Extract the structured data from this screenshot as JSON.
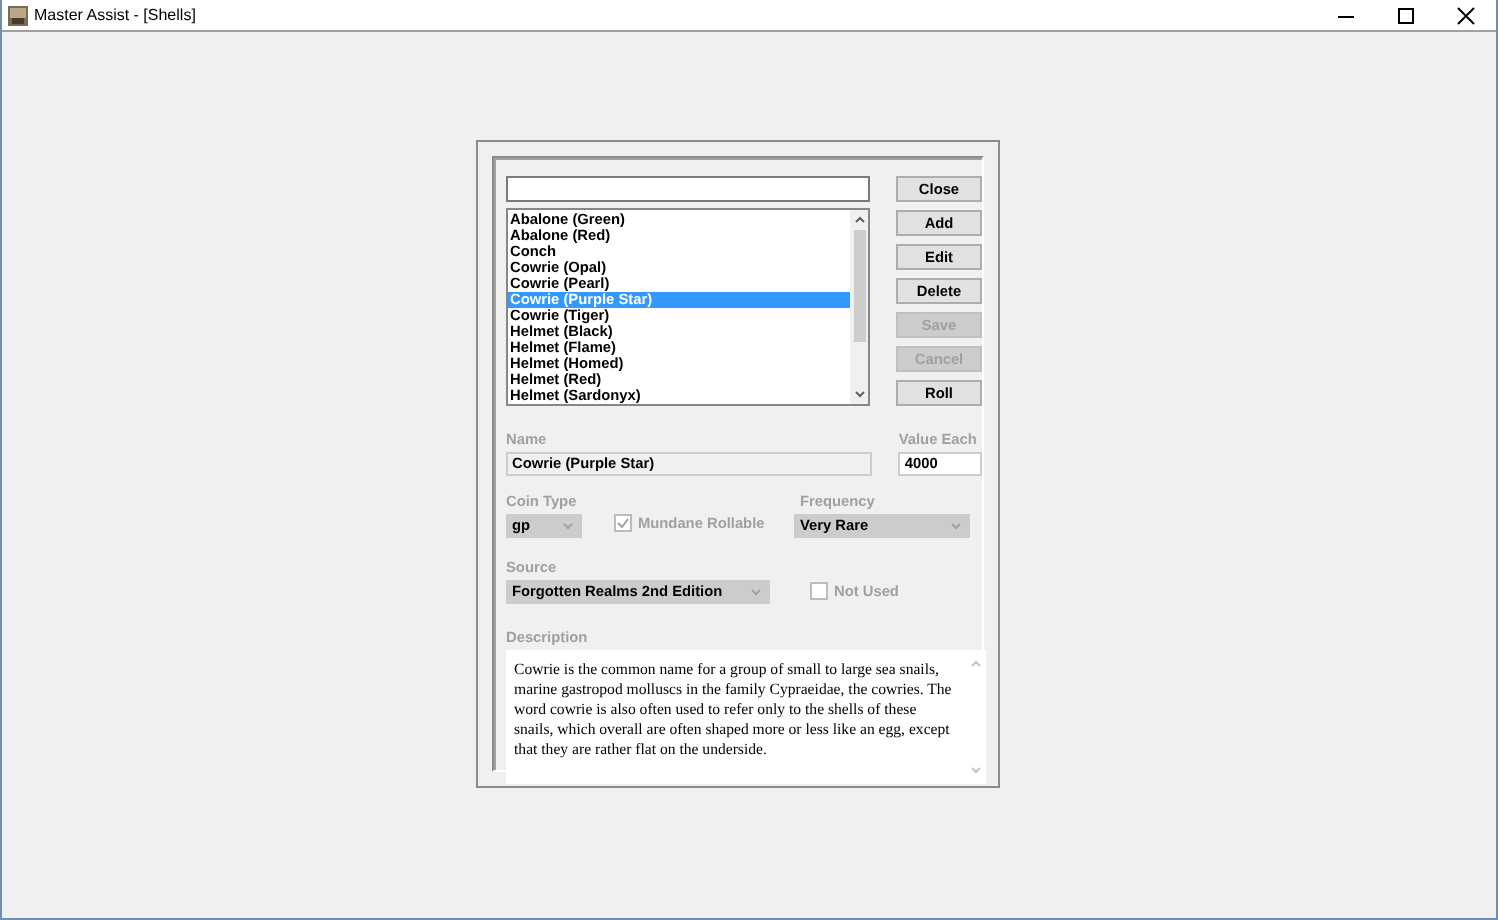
{
  "window": {
    "title": "Master Assist - [Shells]"
  },
  "list": {
    "items": [
      {
        "label": "Abalone (Green)",
        "selected": false
      },
      {
        "label": "Abalone (Red)",
        "selected": false
      },
      {
        "label": "Conch",
        "selected": false
      },
      {
        "label": "Cowrie (Opal)",
        "selected": false
      },
      {
        "label": "Cowrie (Pearl)",
        "selected": false
      },
      {
        "label": "Cowrie (Purple Star)",
        "selected": true
      },
      {
        "label": "Cowrie (Tiger)",
        "selected": false
      },
      {
        "label": "Helmet (Black)",
        "selected": false
      },
      {
        "label": "Helmet (Flame)",
        "selected": false
      },
      {
        "label": "Helmet (Homed)",
        "selected": false
      },
      {
        "label": "Helmet (Red)",
        "selected": false
      },
      {
        "label": "Helmet (Sardonyx)",
        "selected": false
      }
    ]
  },
  "buttons": [
    {
      "label": "Close",
      "disabled": false
    },
    {
      "label": "Add",
      "disabled": false
    },
    {
      "label": "Edit",
      "disabled": false
    },
    {
      "label": "Delete",
      "disabled": false
    },
    {
      "label": "Save",
      "disabled": true
    },
    {
      "label": "Cancel",
      "disabled": true
    },
    {
      "label": "Roll",
      "disabled": false
    }
  ],
  "name": {
    "label": "Name",
    "value": "Cowrie (Purple Star)"
  },
  "value_each": {
    "label": "Value Each",
    "value": "4000"
  },
  "coin_type": {
    "label": "Coin Type",
    "value": "gp"
  },
  "mundane_rollable": {
    "label": "Mundane Rollable",
    "checked": true
  },
  "frequency": {
    "label": "Frequency",
    "value": "Very Rare"
  },
  "source": {
    "label": "Source",
    "value": "Forgotten Realms 2nd Edition"
  },
  "not_used": {
    "label": "Not Used",
    "checked": false
  },
  "description": {
    "label": "Description",
    "text": "Cowrie is the common name for a group of small to large sea snails, marine gastropod molluscs in the family Cypraeidae, the cowries. The word cowrie is also often used to refer only to the shells of these snails, which overall are often shaped more or less like an egg, except that they are rather flat on the underside."
  }
}
